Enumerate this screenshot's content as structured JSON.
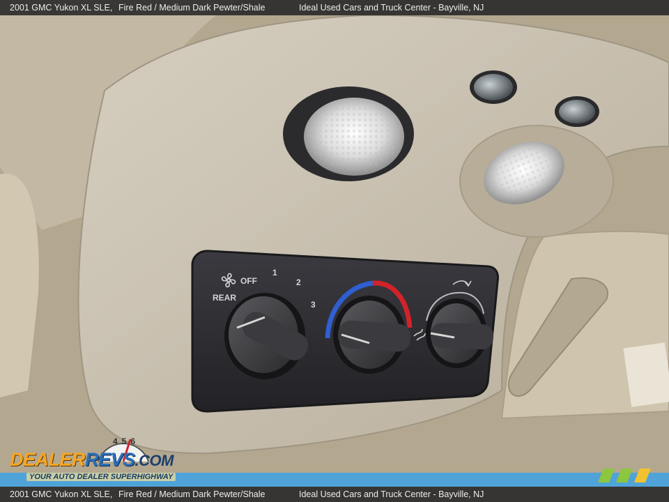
{
  "caption": {
    "vehicle": "2001 GMC Yukon XL SLE,",
    "color": "Fire Red / Medium Dark Pewter/Shale",
    "dealer": "Ideal Used Cars and Truck Center - Bayville, NJ"
  },
  "controls": {
    "fan_off": "OFF",
    "fan_rear": "REAR",
    "speed_1": "1",
    "speed_2": "2",
    "speed_3": "3"
  },
  "watermark": {
    "dealer": "DEALER",
    "revs": "REVS",
    "com": ".COM",
    "tagline": "YOUR AUTO DEALER SUPERHIGHWAY",
    "gauge_digits": "456"
  },
  "colors": {
    "headliner": "#b9ad98",
    "console": "#c8bfae",
    "panel": "#2e2e33",
    "heat_red": "#d1232a",
    "cool_blue": "#2f5fd0",
    "accent_green": "#8dc63f"
  },
  "icons": [
    "fan-icon",
    "recirculate-icon",
    "vent-icon",
    "gauge-icon"
  ]
}
